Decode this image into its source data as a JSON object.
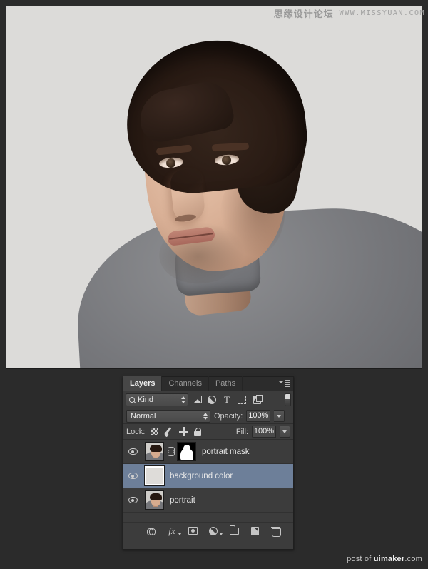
{
  "watermark": {
    "cn_text": "思缘设计论坛",
    "url_text": "WWW.MISSYUAN.COM"
  },
  "footer": {
    "prefix": "post of ",
    "brand": "uimaker",
    "suffix": ".com"
  },
  "panel": {
    "tabs": [
      {
        "label": "Layers",
        "active": true
      },
      {
        "label": "Channels",
        "active": false
      },
      {
        "label": "Paths",
        "active": false
      }
    ],
    "menu_icon": "panel-menu-icon",
    "filter": {
      "kind_label": "Kind",
      "search_icon": "search-icon",
      "icons": [
        "image-filter-icon",
        "adjustment-filter-icon",
        "type-filter-icon",
        "shape-filter-icon",
        "smart-object-filter-icon"
      ],
      "toggle_name": "filter-toggle"
    },
    "blend": {
      "mode": "Normal",
      "opacity_label": "Opacity:",
      "opacity_value": "100%"
    },
    "lock": {
      "label": "Lock:",
      "icons": [
        "lock-transparent-pixels-icon",
        "lock-image-pixels-icon",
        "lock-position-icon",
        "lock-all-icon"
      ],
      "fill_label": "Fill:",
      "fill_value": "100%"
    },
    "layers": [
      {
        "name": "portrait mask",
        "visible": true,
        "selected": false,
        "thumb": "photo",
        "linked": true,
        "mask": true
      },
      {
        "name": "background color",
        "visible": true,
        "selected": true,
        "thumb": "solid",
        "linked": false,
        "mask": false
      },
      {
        "name": "portrait",
        "visible": true,
        "selected": false,
        "thumb": "photo",
        "linked": false,
        "mask": false
      }
    ],
    "bottom_buttons": [
      "link-layers-button",
      "layer-style-button",
      "add-layer-mask-button",
      "new-adjustment-layer-button",
      "new-group-button",
      "new-layer-button",
      "delete-layer-button"
    ]
  },
  "colors": {
    "panel_bg": "#3c3c3c",
    "selected_row": "#6d7f99",
    "app_bg": "#2b2b2b",
    "canvas_bg": "#dcdbd9"
  },
  "canvas": {
    "image_alt": "portrait-photo"
  }
}
